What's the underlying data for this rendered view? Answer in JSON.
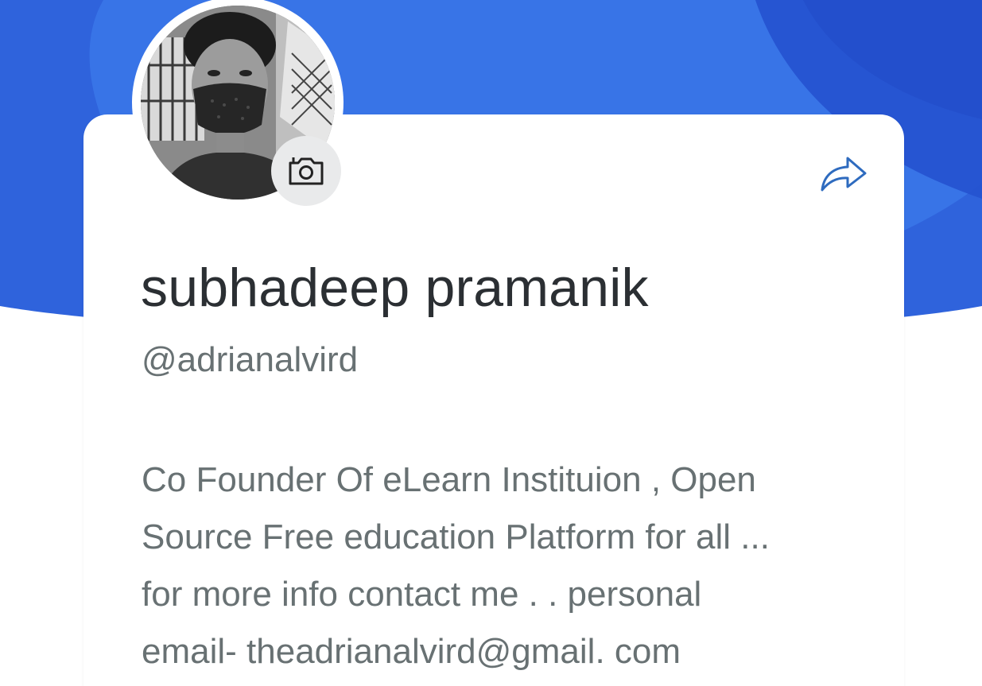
{
  "profile": {
    "display_name": "subhadeep pramanik",
    "username": "@adrianalvird",
    "bio_lines": [
      "Co Founder Of eLearn Instituion , Open",
      "Source Free education Platform for all ...",
      "for more info contact me . . personal",
      "email- theadrianalvird@gmail. com"
    ]
  },
  "icons": {
    "camera": "camera-icon",
    "share": "share-arrow-icon"
  },
  "colors": {
    "header_blue": "#2f63dc",
    "header_blue_light": "#3a72e6",
    "share_icon": "#2e6bbf",
    "name_text": "#2b2f33",
    "secondary_text": "#687173",
    "camera_badge_bg": "#e9eaeb"
  }
}
